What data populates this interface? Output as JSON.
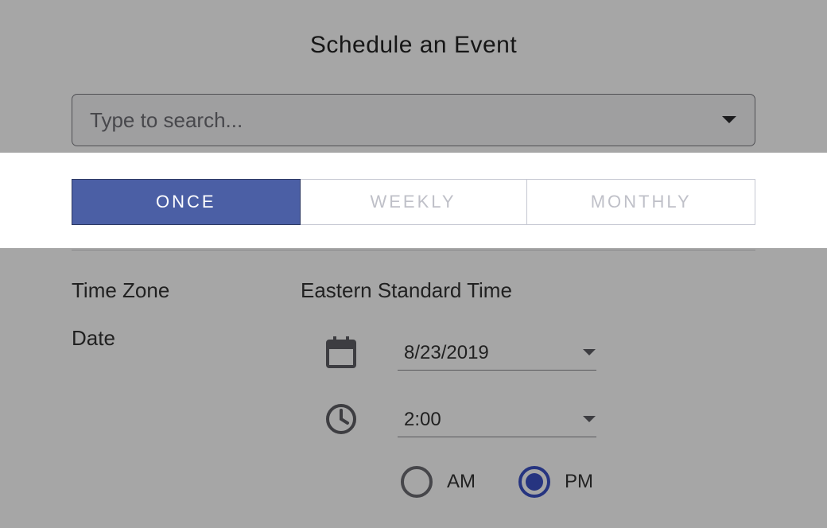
{
  "title": "Schedule an Event",
  "search": {
    "placeholder": "Type to search..."
  },
  "frequency": {
    "tabs": [
      {
        "label": "ONCE",
        "active": true
      },
      {
        "label": "WEEKLY",
        "active": false
      },
      {
        "label": "MONTHLY",
        "active": false
      }
    ]
  },
  "labels": {
    "timezone": "Time Zone",
    "date": "Date"
  },
  "timezone": {
    "value": "Eastern Standard Time"
  },
  "date": {
    "value": "8/23/2019"
  },
  "time": {
    "value": "2:00"
  },
  "ampm": {
    "am": {
      "label": "AM",
      "selected": false
    },
    "pm": {
      "label": "PM",
      "selected": true
    }
  },
  "colors": {
    "accent": "#4b5fa5",
    "radio": "#3b51c5"
  }
}
